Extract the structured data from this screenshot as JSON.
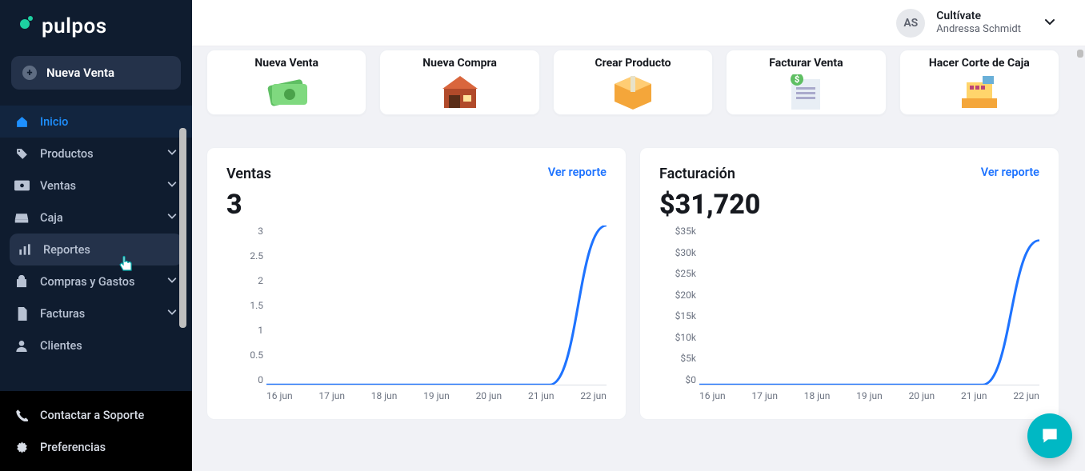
{
  "brand": {
    "name": "pulpos"
  },
  "primary_action": {
    "label": "Nueva Venta"
  },
  "user": {
    "initials": "AS",
    "company": "Cultívate",
    "name": "Andressa Schmidt"
  },
  "sidebar": {
    "items": [
      {
        "label": "Inicio",
        "icon": "home",
        "chevron": false,
        "state": "active"
      },
      {
        "label": "Productos",
        "icon": "tag",
        "chevron": true,
        "state": ""
      },
      {
        "label": "Ventas",
        "icon": "cash",
        "chevron": true,
        "state": ""
      },
      {
        "label": "Caja",
        "icon": "drawer",
        "chevron": true,
        "state": ""
      },
      {
        "label": "Reportes",
        "icon": "bars",
        "chevron": false,
        "state": "hovered"
      },
      {
        "label": "Compras y Gastos",
        "icon": "bag",
        "chevron": true,
        "state": ""
      },
      {
        "label": "Facturas",
        "icon": "doc",
        "chevron": true,
        "state": ""
      },
      {
        "label": "Clientes",
        "icon": "person",
        "chevron": false,
        "state": ""
      }
    ],
    "footer": [
      {
        "label": "Contactar a Soporte",
        "icon": "phone"
      },
      {
        "label": "Preferencias",
        "icon": "gear"
      }
    ]
  },
  "quick": [
    {
      "label": "Nueva Venta",
      "icon": "money"
    },
    {
      "label": "Nueva Compra",
      "icon": "store"
    },
    {
      "label": "Crear Producto",
      "icon": "box"
    },
    {
      "label": "Facturar Venta",
      "icon": "invoice"
    },
    {
      "label": "Hacer Corte de Caja",
      "icon": "register"
    }
  ],
  "panels": {
    "ventas": {
      "title": "Ventas",
      "report_link": "Ver reporte",
      "metric": "3"
    },
    "facturacion": {
      "title": "Facturación",
      "report_link": "Ver reporte",
      "metric": "$31,720"
    }
  },
  "chart_data": [
    {
      "type": "line",
      "title": "Ventas",
      "categories": [
        "16 jun",
        "17 jun",
        "18 jun",
        "19 jun",
        "20 jun",
        "21 jun",
        "22 jun"
      ],
      "values": [
        0,
        0,
        0,
        0,
        0,
        0,
        3
      ],
      "ylabels": [
        "3",
        "2.5",
        "2",
        "1.5",
        "1",
        "0.5",
        "0"
      ],
      "ylim": [
        0,
        3
      ]
    },
    {
      "type": "line",
      "title": "Facturación",
      "categories": [
        "16 jun",
        "17 jun",
        "18 jun",
        "19 jun",
        "20 jun",
        "21 jun",
        "22 jun"
      ],
      "values": [
        0,
        0,
        0,
        0,
        0,
        0,
        31720
      ],
      "ylabels": [
        "$35k",
        "$30k",
        "$25k",
        "$20k",
        "$15k",
        "$10k",
        "$5k",
        "$0"
      ],
      "ylim": [
        0,
        35000
      ]
    }
  ]
}
